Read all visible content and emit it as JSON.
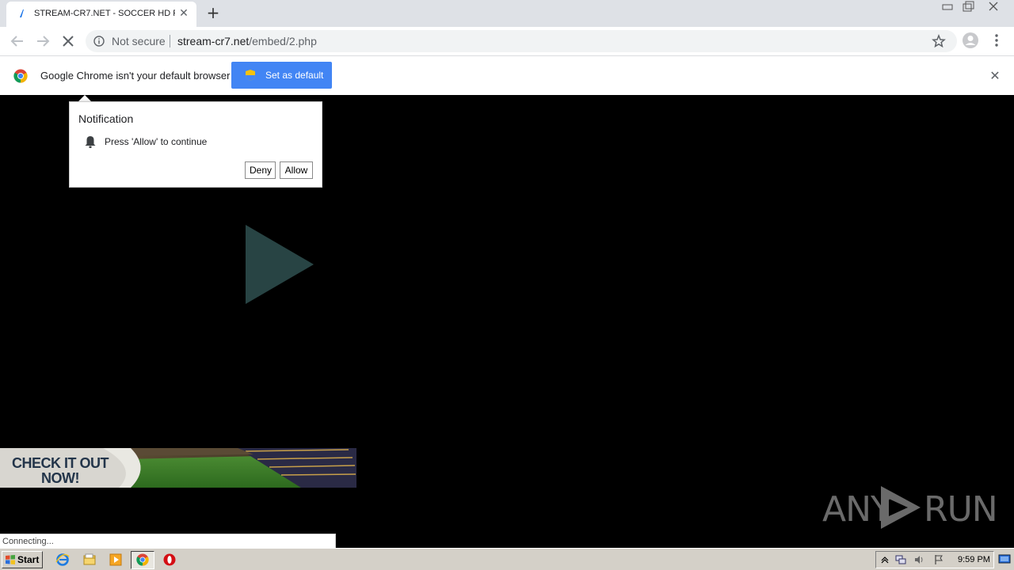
{
  "browser": {
    "tab": {
      "title": "STREAM-CR7.NET - SOCCER HD Pla",
      "close_label": "✕"
    },
    "new_tab_label": "+",
    "security_label": "Not secure",
    "url_host": "stream-cr7.net",
    "url_path": "/embed/2.php"
  },
  "infobar": {
    "message": "Google Chrome isn't your default browser",
    "button_label": "Set as default",
    "close_label": "✕"
  },
  "notification": {
    "title": "Notification",
    "message": "Press 'Allow' to continue",
    "deny_label": "Deny",
    "allow_label": "Allow"
  },
  "banner": {
    "line1": "CHECK IT OUT",
    "line2": "NOW!"
  },
  "watermark": {
    "text_left": "ANY",
    "text_right": "RUN"
  },
  "status_bar": "Connecting...",
  "taskbar": {
    "start_label": "Start",
    "clock": "9:59 PM"
  },
  "colors": {
    "accent_blue": "#4285f4",
    "play_button": "#2a4a4a",
    "page_bg": "#000000"
  }
}
